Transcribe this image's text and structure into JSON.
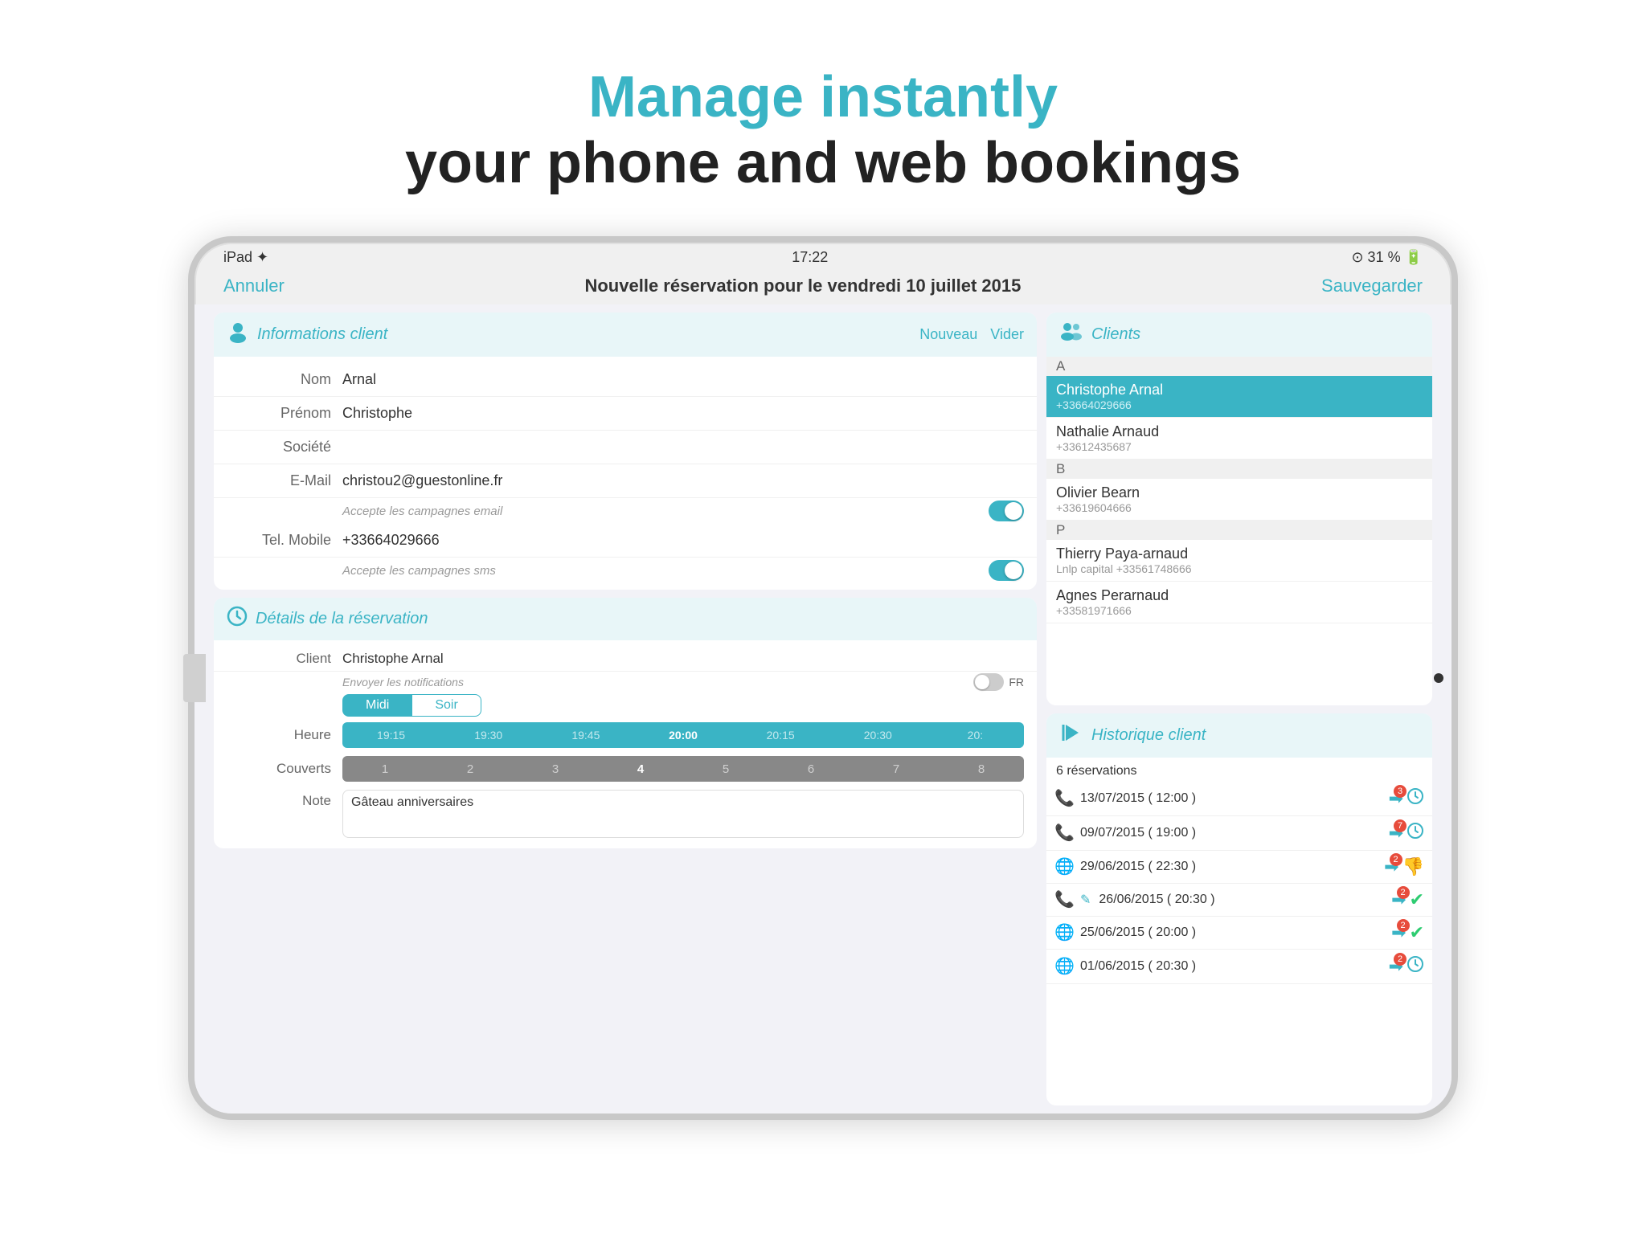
{
  "header": {
    "line1": "Manage instantly",
    "line2": "your phone and web bookings"
  },
  "ipad": {
    "status": {
      "left": "iPad ✦",
      "center": "17:22",
      "right": "⊙  31 %  🔋"
    },
    "nav": {
      "cancel": "Annuler",
      "title": "Nouvelle réservation pour le vendredi 10 juillet 2015",
      "save": "Sauvegarder"
    },
    "client_info": {
      "section_title": "Informations client",
      "btn_nouveau": "Nouveau",
      "btn_vider": "Vider",
      "fields": {
        "nom_label": "Nom",
        "nom_value": "Arnal",
        "prenom_label": "Prénom",
        "prenom_value": "Christophe",
        "societe_label": "Société",
        "societe_value": "",
        "email_label": "E-Mail",
        "email_value": "christou2@guestonline.fr",
        "email_toggle_label": "Accepte les campagnes email",
        "tel_label": "Tel. Mobile",
        "tel_value": "+33664029666",
        "tel_toggle_label": "Accepte les campagnes sms"
      }
    },
    "clients_list": {
      "section_title": "Clients",
      "groups": [
        {
          "letter": "A",
          "clients": [
            {
              "name": "Christophe Arnal",
              "phone": "+33664029666",
              "selected": true
            },
            {
              "name": "Nathalie Arnaud",
              "phone": "+33612435687",
              "selected": false
            }
          ]
        },
        {
          "letter": "B",
          "clients": [
            {
              "name": "Olivier Bearn",
              "phone": "+33619604666",
              "selected": false
            }
          ]
        },
        {
          "letter": "P",
          "clients": [
            {
              "name": "Thierry Paya-arnaud",
              "phone": "Lnlp capital +33561748666",
              "selected": false
            },
            {
              "name": "Agnes Perarnaud",
              "phone": "+33581971666",
              "selected": false
            }
          ]
        }
      ]
    },
    "details": {
      "section_title": "Détails de la réservation",
      "client_label": "Client",
      "client_value": "Christophe Arnal",
      "notif_label": "Envoyer les notifications",
      "notif_lang": "FR",
      "meal_options": [
        "Midi",
        "Soir"
      ],
      "meal_selected": "Midi",
      "heure_label": "Heure",
      "time_slots": [
        "19:15",
        "19:30",
        "19:45",
        "20:00",
        "20:15",
        "20:30",
        "20:"
      ],
      "time_selected": "20:00",
      "couverts_label": "Couverts",
      "covers": [
        1,
        2,
        3,
        4,
        5,
        6,
        7,
        8
      ],
      "covers_selected": 4,
      "note_label": "Note",
      "note_value": "Gâteau anniversaires"
    },
    "history": {
      "section_title": "Historique client",
      "count": "6 réservations",
      "items": [
        {
          "channel": "phone",
          "date": "13/07/2015 ( 12:00 )",
          "badge": "3",
          "status": "clock"
        },
        {
          "channel": "phone",
          "date": "09/07/2015 ( 19:00 )",
          "badge": "7",
          "status": "clock"
        },
        {
          "channel": "web",
          "date": "29/06/2015 ( 22:30 )",
          "badge": "2",
          "status": "cancel"
        },
        {
          "channel": "phone+edit",
          "date": "26/06/2015 ( 20:30 )",
          "badge": "2",
          "status": "ok"
        },
        {
          "channel": "web",
          "date": "25/06/2015 ( 20:00 )",
          "badge": "2",
          "status": "ok"
        },
        {
          "channel": "web",
          "date": "01/06/2015 ( 20:30 )",
          "badge": "2",
          "status": "clock"
        }
      ]
    }
  }
}
